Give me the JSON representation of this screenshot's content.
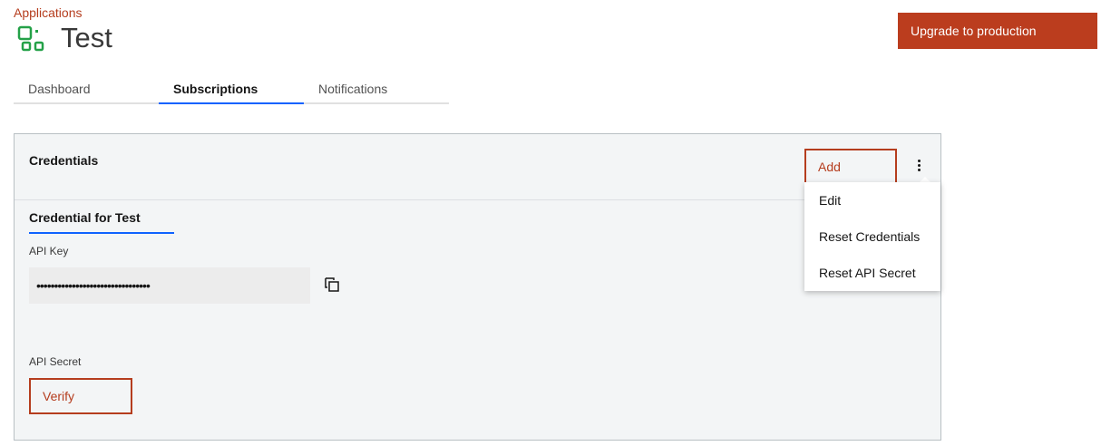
{
  "breadcrumb": {
    "label": "Applications"
  },
  "header": {
    "title": "Test",
    "icon": "app-grid-icon",
    "upgrade_label": "Upgrade to production"
  },
  "tabs": [
    {
      "label": "Dashboard",
      "active": false
    },
    {
      "label": "Subscriptions",
      "active": true
    },
    {
      "label": "Notifications",
      "active": false
    }
  ],
  "credentials": {
    "title": "Credentials",
    "add_label": "Add",
    "overflow_icon": "overflow-menu-vertical-icon",
    "credential_tab": "Credential for Test",
    "api_key_label": "API Key",
    "api_key_value": "••••••••••••••••••••••••••••••••",
    "copy_icon": "copy-icon",
    "api_secret_label": "API Secret",
    "verify_label": "Verify"
  },
  "menu": {
    "items": [
      "Edit",
      "Reset Credentials",
      "Reset API Secret"
    ]
  },
  "colors": {
    "accent": "#b53d1e",
    "primary_button": "#bb3d1e",
    "tab_indicator": "#0f62fe",
    "icon_green": "#24a148",
    "panel_bg": "#f3f5f6"
  }
}
